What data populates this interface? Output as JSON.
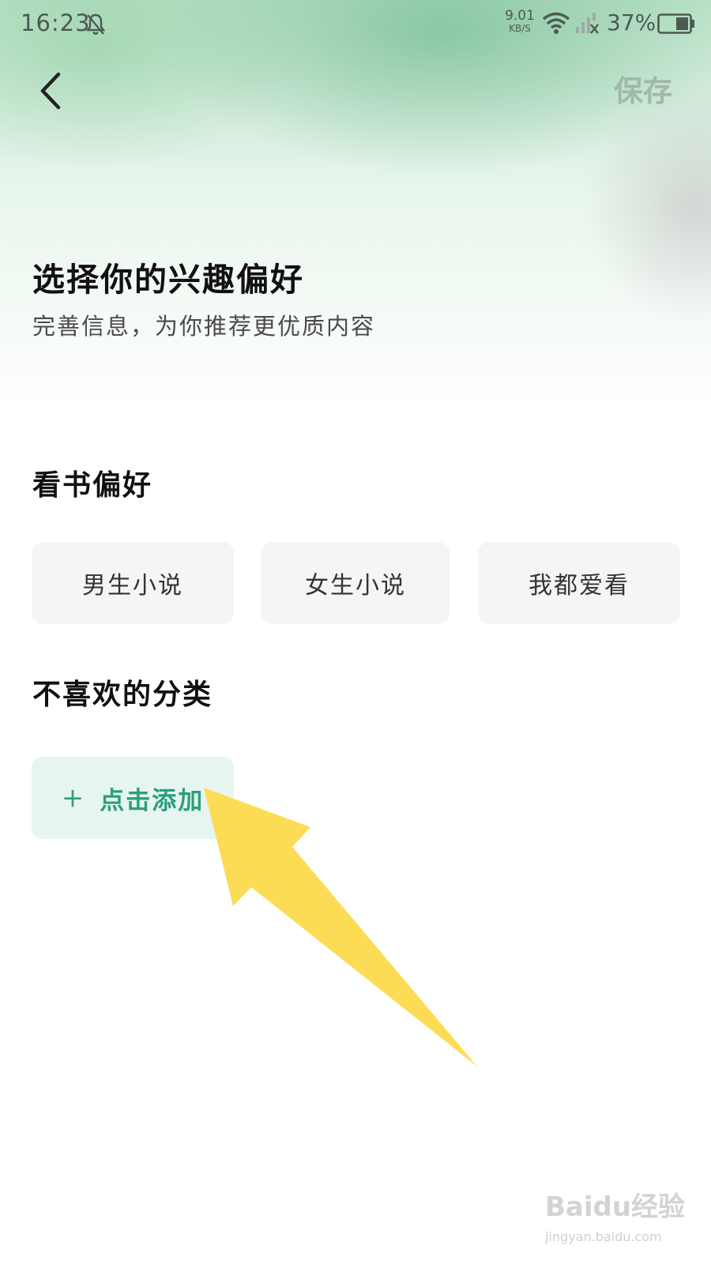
{
  "status_bar": {
    "time": "16:23",
    "net_speed_value": "9.01",
    "net_speed_unit": "KB/S",
    "battery": "37%"
  },
  "header": {
    "back_icon": "chevron-left-icon",
    "save_label": "保存"
  },
  "intro": {
    "title": "选择你的兴趣偏好",
    "subtitle": "完善信息，为你推荐更优质内容"
  },
  "reading_preference": {
    "title": "看书偏好",
    "options": [
      "男生小说",
      "女生小说",
      "我都爱看"
    ]
  },
  "disliked_categories": {
    "title": "不喜欢的分类",
    "add_label": "点击添加",
    "add_icon": "plus-icon"
  },
  "annotation": {
    "arrow_color": "#FDDC55"
  },
  "watermark": {
    "logo": "Baidu经验",
    "url": "jingyan.baidu.com"
  },
  "colors": {
    "accent_green": "#2A9F7E",
    "save_text": "#9FB8AA",
    "chip_bg": "#F5F5F5",
    "add_bg": "#E6F5F0"
  }
}
